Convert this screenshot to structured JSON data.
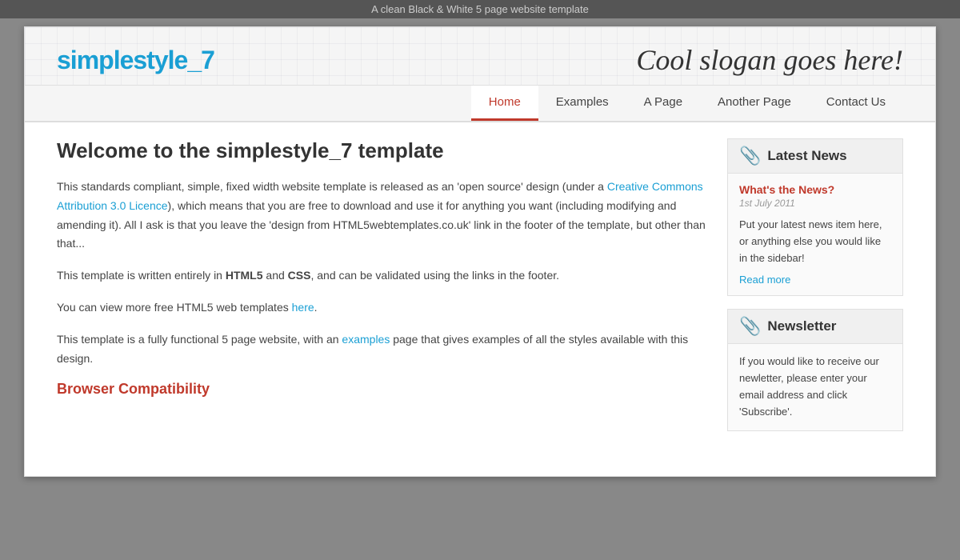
{
  "topbar": {
    "text": "A clean Black & White 5 page website template"
  },
  "header": {
    "logo_prefix": "simplestyle",
    "logo_suffix": "_7",
    "slogan": "Cool slogan goes here!"
  },
  "nav": {
    "tabs": [
      {
        "label": "Home",
        "active": true
      },
      {
        "label": "Examples",
        "active": false
      },
      {
        "label": "A Page",
        "active": false
      },
      {
        "label": "Another Page",
        "active": false
      },
      {
        "label": "Contact Us",
        "active": false
      }
    ]
  },
  "main": {
    "heading": "Welcome to the simplestyle_7 template",
    "para1_before": "This standards compliant, simple, fixed width website template is released as an 'open source' design (under a ",
    "para1_link_text": "Creative Commons Attribution 3.0 Licence",
    "para1_after": "), which means that you are free to download and use it for anything you want (including modifying and amending it). All I ask is that you leave the 'design from HTML5webtemplates.co.uk' link in the footer of the template, but other than that...",
    "para2_before": "This template is written entirely in ",
    "para2_html5": "HTML5",
    "para2_mid": " and ",
    "para2_css": "CSS",
    "para2_after": ", and can be validated using the links in the footer.",
    "para3_before": "You can view more free HTML5 web templates ",
    "para3_link": "here",
    "para3_after": ".",
    "para4_before": "This template is a fully functional 5 page website, with an ",
    "para4_link": "examples",
    "para4_after": " page that gives examples of all the styles available with this design.",
    "browser_compat_heading": "Browser Compatibility"
  },
  "sidebar": {
    "latest_news": {
      "widget_title": "Latest News",
      "news_title": "What's the News?",
      "news_date": "1st July 2011",
      "news_text": "Put your latest news item here, or anything else you would like in the sidebar!",
      "read_more": "Read more"
    },
    "newsletter": {
      "widget_title": "Newsletter",
      "newsletter_text": "If you would like to receive our newletter, please enter your email address and click 'Subscribe'."
    }
  }
}
